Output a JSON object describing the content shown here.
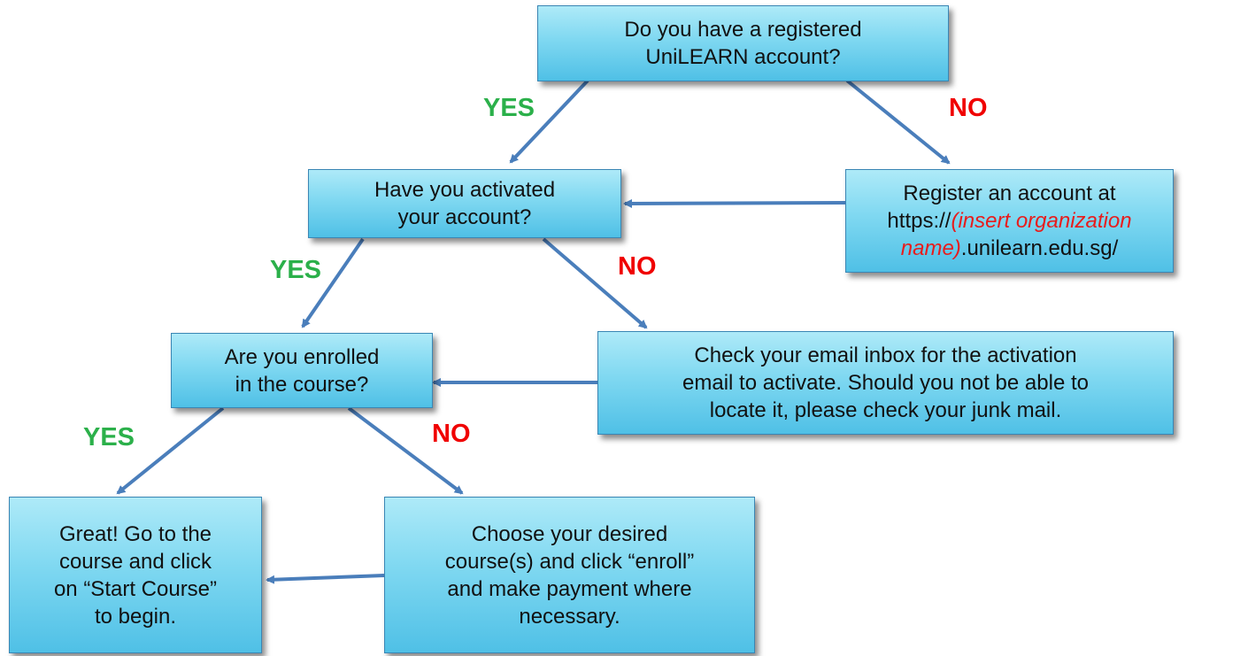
{
  "nodes": {
    "q1": {
      "lines": [
        "Do you have a registered",
        "UniLEARN account?"
      ]
    },
    "q2": {
      "lines": [
        "Have you activated",
        "your account?"
      ]
    },
    "register": {
      "line1": "Register an account at",
      "prefix": "https://",
      "insert": "(insert organization name)",
      "suffix": ".unilearn.edu.sg/"
    },
    "q3": {
      "lines": [
        "Are you enrolled",
        "in the course?"
      ]
    },
    "check_email": {
      "lines": [
        "Check your email inbox for the activation",
        "email to activate. Should you not be able to",
        "locate it, please check your junk mail."
      ]
    },
    "start_course": {
      "lines": [
        "Great! Go to the",
        "course and click",
        "on “Start Course”",
        "to begin."
      ]
    },
    "enroll": {
      "lines": [
        "Choose your desired",
        "course(s) and click “enroll”",
        "and make payment where",
        "necessary."
      ]
    }
  },
  "labels": {
    "yes1": "YES",
    "no1": "NO",
    "yes2": "YES",
    "no2": "NO",
    "yes3": "YES",
    "no3": "NO"
  },
  "colors": {
    "yes": "#2bb04a",
    "no": "#f00000",
    "arrow": "#4a7ebb",
    "box_top": "#aeeaf8",
    "box_bottom": "#4fc0e6"
  }
}
